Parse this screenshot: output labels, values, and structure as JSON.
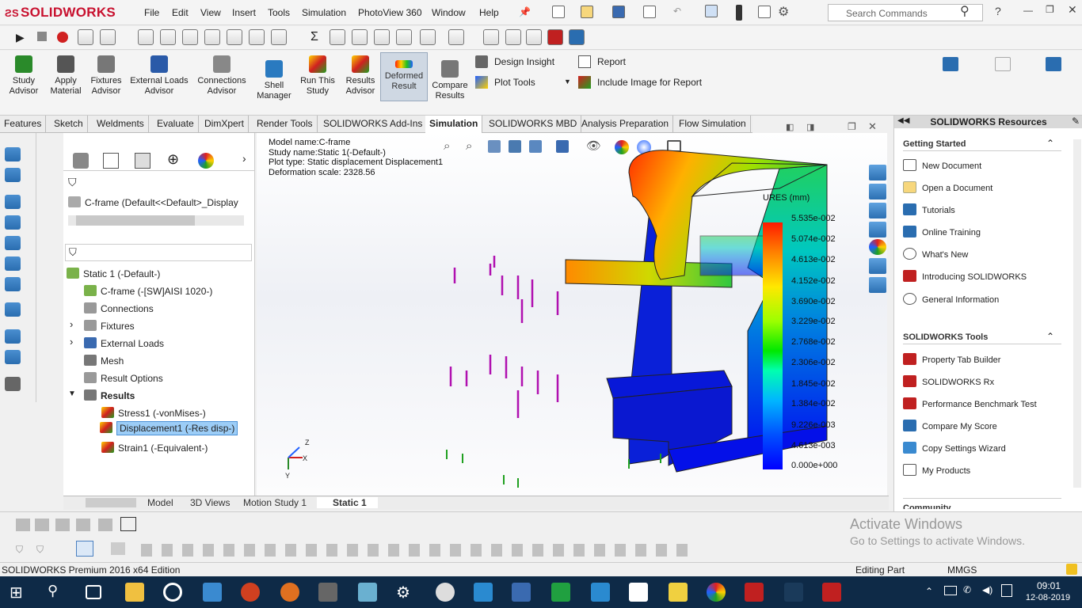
{
  "app": {
    "logo": "SOLIDWORKS"
  },
  "menu": [
    "File",
    "Edit",
    "View",
    "Insert",
    "Tools",
    "Simulation",
    "PhotoView 360",
    "Window",
    "Help"
  ],
  "search": {
    "placeholder": "Search Commands"
  },
  "ribbon": {
    "buttons": [
      {
        "label": "Study Advisor",
        "color": "#2a8a2a"
      },
      {
        "label": "Apply Material",
        "color": "#555555"
      },
      {
        "label": "Fixtures Advisor",
        "color": "#666666"
      },
      {
        "label": "External Loads Advisor",
        "color": "#2a5aa8"
      },
      {
        "label": "Connections Advisor",
        "color": "#777777"
      },
      {
        "label": "Shell Manager",
        "color": "#2a7ac0"
      },
      {
        "label": "Run This Study",
        "color": "#d02020"
      },
      {
        "label": "Results Advisor",
        "color": "#d02020"
      },
      {
        "label": "Deformed Result",
        "color": "#e06020"
      },
      {
        "label": "Compare Results",
        "color": "#555555"
      }
    ],
    "design_insight": "Design Insight",
    "plot_tools": "Plot Tools",
    "report": "Report",
    "include_image": "Include Image for Report"
  },
  "tabs": [
    "Features",
    "Sketch",
    "Weldments",
    "Evaluate",
    "DimXpert",
    "Render Tools",
    "SOLIDWORKS Add-Ins",
    "Simulation",
    "SOLIDWORKS MBD",
    "Analysis Preparation",
    "Flow Simulation"
  ],
  "active_tab": "Simulation",
  "feature_tree": {
    "part": "C-frame  (Default<<Default>_Display",
    "study": "Static 1 (-Default-)",
    "items": [
      {
        "label": "C-frame (-[SW]AISI 1020-)",
        "expand": "",
        "color": "#7ab24a"
      },
      {
        "label": "Connections",
        "expand": "",
        "color": "#888888"
      },
      {
        "label": "Fixtures",
        "expand": "›",
        "color": "#888888"
      },
      {
        "label": "External Loads",
        "expand": "›",
        "color": "#3a6ab0"
      },
      {
        "label": "Mesh",
        "expand": "",
        "color": "#777777"
      },
      {
        "label": "Result Options",
        "expand": "",
        "color": "#888888"
      }
    ],
    "results_label": "Results",
    "results": [
      {
        "label": "Stress1 (-vonMises-)",
        "selected": false
      },
      {
        "label": "Displacement1 (-Res disp-)",
        "selected": true
      },
      {
        "label": "Strain1 (-Equivalent-)",
        "selected": false
      }
    ]
  },
  "viewport": {
    "info_lines": [
      "Model name:C-frame",
      "Study name:Static 1(-Default-)",
      "Plot type: Static displacement Displacement1",
      "Deformation scale: 2328.56"
    ],
    "legend_title": "URES (mm)",
    "legend_values": [
      "5.535e-002",
      "5.074e-002",
      "4.613e-002",
      "4.152e-002",
      "3.690e-002",
      "3.229e-002",
      "2.768e-002",
      "2.306e-002",
      "1.845e-002",
      "1.384e-002",
      "9.226e-003",
      "4.613e-003",
      "0.000e+000"
    ],
    "triad": {
      "x": "X",
      "y": "Y",
      "z": "Z"
    }
  },
  "bottom_tabs": [
    "Model",
    "3D Views",
    "Motion Study 1",
    "Static 1"
  ],
  "resources": {
    "title": "SOLIDWORKS Resources",
    "getting_started": "Getting Started",
    "gs_items": [
      "New Document",
      "Open a Document",
      "Tutorials",
      "Online Training",
      "What's New",
      "Introducing SOLIDWORKS",
      "General Information"
    ],
    "tools_title": "SOLIDWORKS Tools",
    "tools_items": [
      "Property Tab Builder",
      "SOLIDWORKS Rx",
      "Performance Benchmark Test",
      "Compare My Score",
      "Copy Settings Wizard",
      "My Products"
    ],
    "community": "Community"
  },
  "status": {
    "edition": "SOLIDWORKS Premium 2016 x64 Edition",
    "mode": "Editing Part",
    "units": "MMGS"
  },
  "watermark": {
    "line1": "Activate Windows",
    "line2": "Go to Settings to activate Windows."
  },
  "taskbar": {
    "time": "09:01",
    "date": "12-08-2019"
  }
}
